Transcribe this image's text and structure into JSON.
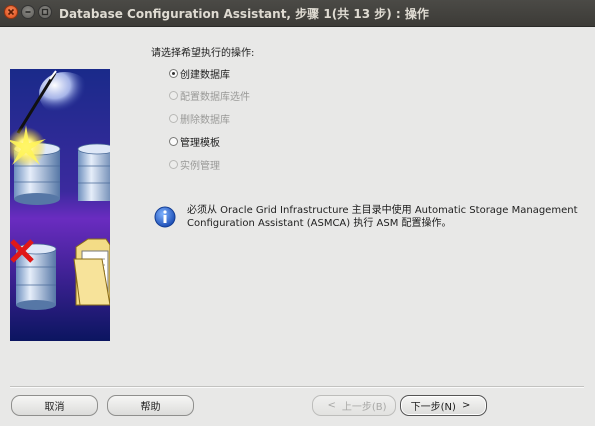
{
  "window": {
    "title": "Database Configuration Assistant, 步骤 1(共 13 步) : 操作"
  },
  "prompt": "请选择希望执行的操作:",
  "options": [
    {
      "label": "创建数据库",
      "selected": true,
      "enabled": true
    },
    {
      "label": "配置数据库选件",
      "selected": false,
      "enabled": false
    },
    {
      "label": "删除数据库",
      "selected": false,
      "enabled": false
    },
    {
      "label": "管理模板",
      "selected": false,
      "enabled": true
    },
    {
      "label": "实例管理",
      "selected": false,
      "enabled": false
    }
  ],
  "info": {
    "icon": "info-icon",
    "line1": "必须从 Oracle Grid Infrastructure 主目录中使用 Automatic Storage Management",
    "line2": "Configuration Assistant (ASMCA) 执行 ASM 配置操作。"
  },
  "buttons": {
    "cancel": "取消",
    "help": "帮助",
    "back": "上一步(B)",
    "next": "下一步(N)",
    "back_enabled": false,
    "next_enabled": true
  }
}
